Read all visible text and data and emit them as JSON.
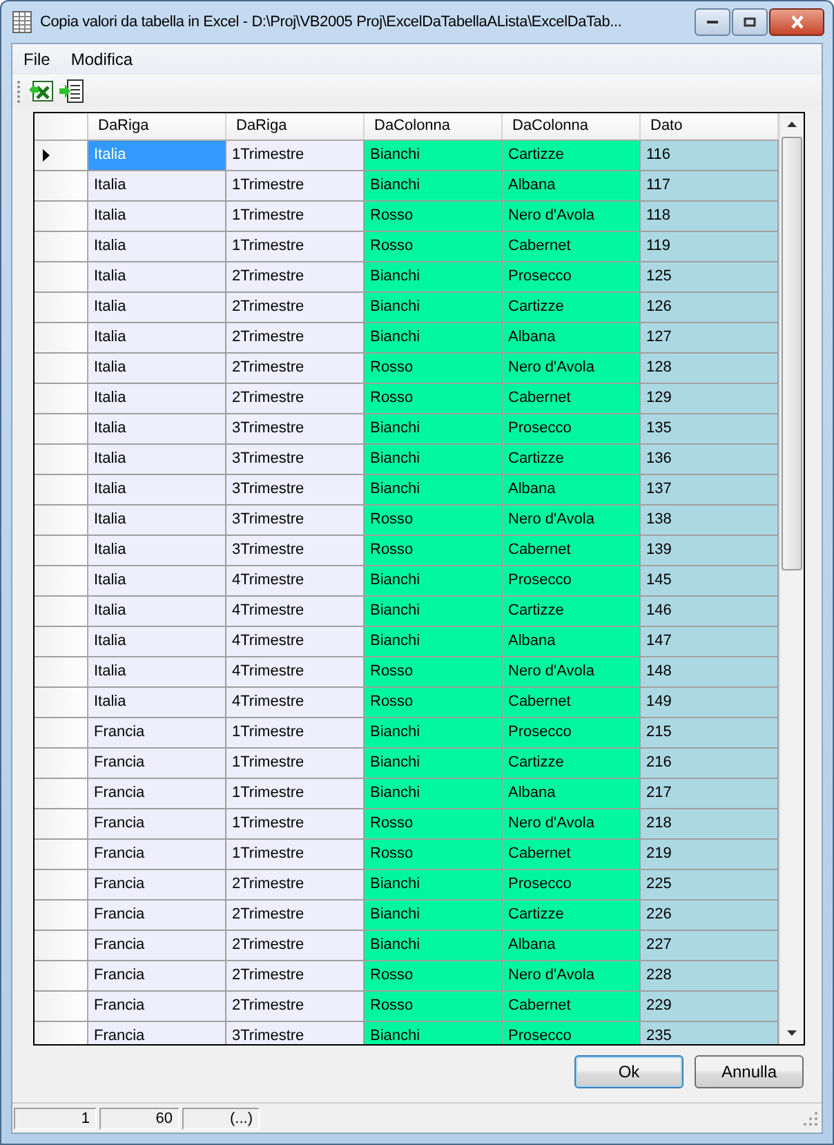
{
  "window": {
    "title": "Copia valori da tabella in Excel - D:\\Proj\\VB2005 Proj\\ExcelDaTabellaALista\\ExcelDaTab..."
  },
  "menu": [
    "File",
    "Modifica"
  ],
  "table": {
    "columns": [
      "DaRiga",
      "DaRiga",
      "DaColonna",
      "DaColonna",
      "Dato"
    ],
    "rows": [
      {
        "cells": [
          "Italia",
          "1Trimestre",
          "Bianchi",
          "Cartizze",
          "116"
        ],
        "selected": true
      },
      {
        "cells": [
          "Italia",
          "1Trimestre",
          "Bianchi",
          "Albana",
          "117"
        ],
        "selected": false
      },
      {
        "cells": [
          "Italia",
          "1Trimestre",
          "Rosso",
          "Nero d'Avola",
          "118"
        ],
        "selected": false
      },
      {
        "cells": [
          "Italia",
          "1Trimestre",
          "Rosso",
          "Cabernet",
          "119"
        ],
        "selected": false
      },
      {
        "cells": [
          "Italia",
          "2Trimestre",
          "Bianchi",
          "Prosecco",
          "125"
        ],
        "selected": false
      },
      {
        "cells": [
          "Italia",
          "2Trimestre",
          "Bianchi",
          "Cartizze",
          "126"
        ],
        "selected": false
      },
      {
        "cells": [
          "Italia",
          "2Trimestre",
          "Bianchi",
          "Albana",
          "127"
        ],
        "selected": false
      },
      {
        "cells": [
          "Italia",
          "2Trimestre",
          "Rosso",
          "Nero d'Avola",
          "128"
        ],
        "selected": false
      },
      {
        "cells": [
          "Italia",
          "2Trimestre",
          "Rosso",
          "Cabernet",
          "129"
        ],
        "selected": false
      },
      {
        "cells": [
          "Italia",
          "3Trimestre",
          "Bianchi",
          "Prosecco",
          "135"
        ],
        "selected": false
      },
      {
        "cells": [
          "Italia",
          "3Trimestre",
          "Bianchi",
          "Cartizze",
          "136"
        ],
        "selected": false
      },
      {
        "cells": [
          "Italia",
          "3Trimestre",
          "Bianchi",
          "Albana",
          "137"
        ],
        "selected": false
      },
      {
        "cells": [
          "Italia",
          "3Trimestre",
          "Rosso",
          "Nero d'Avola",
          "138"
        ],
        "selected": false
      },
      {
        "cells": [
          "Italia",
          "3Trimestre",
          "Rosso",
          "Cabernet",
          "139"
        ],
        "selected": false
      },
      {
        "cells": [
          "Italia",
          "4Trimestre",
          "Bianchi",
          "Prosecco",
          "145"
        ],
        "selected": false
      },
      {
        "cells": [
          "Italia",
          "4Trimestre",
          "Bianchi",
          "Cartizze",
          "146"
        ],
        "selected": false
      },
      {
        "cells": [
          "Italia",
          "4Trimestre",
          "Bianchi",
          "Albana",
          "147"
        ],
        "selected": false
      },
      {
        "cells": [
          "Italia",
          "4Trimestre",
          "Rosso",
          "Nero d'Avola",
          "148"
        ],
        "selected": false
      },
      {
        "cells": [
          "Italia",
          "4Trimestre",
          "Rosso",
          "Cabernet",
          "149"
        ],
        "selected": false
      },
      {
        "cells": [
          "Francia",
          "1Trimestre",
          "Bianchi",
          "Prosecco",
          "215"
        ],
        "selected": false
      },
      {
        "cells": [
          "Francia",
          "1Trimestre",
          "Bianchi",
          "Cartizze",
          "216"
        ],
        "selected": false
      },
      {
        "cells": [
          "Francia",
          "1Trimestre",
          "Bianchi",
          "Albana",
          "217"
        ],
        "selected": false
      },
      {
        "cells": [
          "Francia",
          "1Trimestre",
          "Rosso",
          "Nero d'Avola",
          "218"
        ],
        "selected": false
      },
      {
        "cells": [
          "Francia",
          "1Trimestre",
          "Rosso",
          "Cabernet",
          "219"
        ],
        "selected": false
      },
      {
        "cells": [
          "Francia",
          "2Trimestre",
          "Bianchi",
          "Prosecco",
          "225"
        ],
        "selected": false
      },
      {
        "cells": [
          "Francia",
          "2Trimestre",
          "Bianchi",
          "Cartizze",
          "226"
        ],
        "selected": false
      },
      {
        "cells": [
          "Francia",
          "2Trimestre",
          "Bianchi",
          "Albana",
          "227"
        ],
        "selected": false
      },
      {
        "cells": [
          "Francia",
          "2Trimestre",
          "Rosso",
          "Nero d'Avola",
          "228"
        ],
        "selected": false
      },
      {
        "cells": [
          "Francia",
          "2Trimestre",
          "Rosso",
          "Cabernet",
          "229"
        ],
        "selected": false
      },
      {
        "cells": [
          "Francia",
          "3Trimestre",
          "Bianchi",
          "Prosecco",
          "235"
        ],
        "selected": false
      }
    ]
  },
  "buttons": [
    {
      "label": "Ok",
      "default": true
    },
    {
      "label": "Annulla",
      "default": false
    }
  ],
  "status_bar": [
    "1",
    "60",
    "(...)"
  ]
}
